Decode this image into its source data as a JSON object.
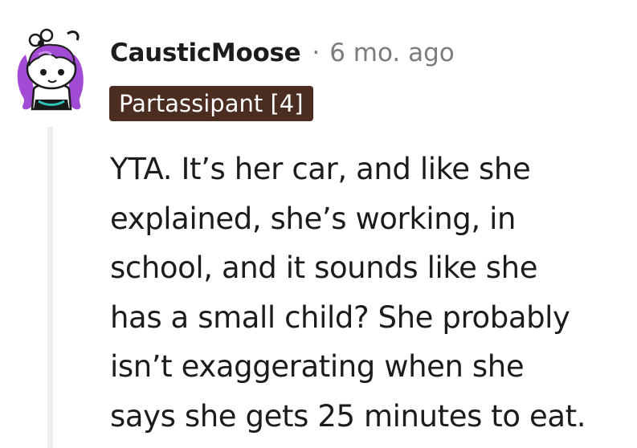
{
  "comment": {
    "author": "CausticMoose",
    "separator": "·",
    "timestamp": "6 mo. ago",
    "flair": "Partassipant [4]",
    "body_lines": [
      "YTA. It’s her car, and like she",
      "explained, she’s working, in",
      "school, and it sounds like she",
      "has a small child? She probably",
      "isn’t exaggerating when she",
      "says she gets 25 minutes to eat."
    ],
    "colors": {
      "flair_background": "#4b2d22",
      "flair_text": "#ffffff",
      "meta_text": "#7c7c7c",
      "body_text": "#1c1c1c",
      "thread_line": "#eceef0",
      "avatar_hair": "#a24bd4"
    },
    "avatar_icon": "snoo-avatar-icon"
  }
}
